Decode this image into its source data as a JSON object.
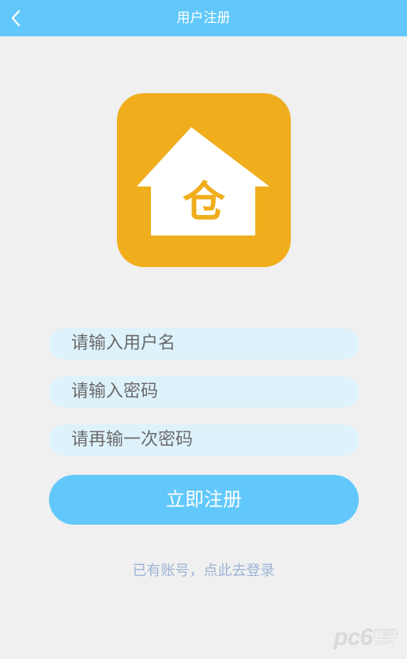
{
  "header": {
    "title": "用户注册",
    "back_icon": "chevron-left-icon"
  },
  "logo": {
    "icon": "house-icon",
    "char": "仓",
    "bg_color": "#f0ae1d"
  },
  "form": {
    "username_placeholder": "请输入用户名",
    "password_placeholder": "请输入密码",
    "confirm_placeholder": "请再输一次密码",
    "submit_label": "立即注册"
  },
  "footer": {
    "login_link": "已有账号，点此去登录"
  },
  "watermark": {
    "main": "pc6",
    "badge": "下载站",
    "suffix": ".com"
  },
  "colors": {
    "accent": "#62c8fb",
    "field_bg": "#def2fb",
    "background": "#f0f0f0",
    "link": "#9db4d6"
  }
}
